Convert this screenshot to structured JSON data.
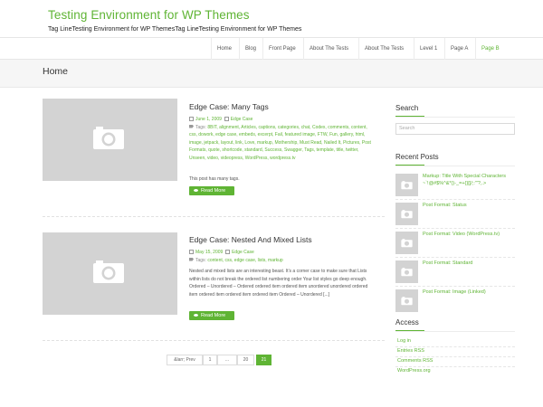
{
  "site": {
    "title": "Testing Environment for WP Themes",
    "description": "Tag LineTesting Environment for WP ThemesTag LineTesting Environment for WP Themes"
  },
  "nav": {
    "items": [
      {
        "label": "Home"
      },
      {
        "label": "Blog"
      },
      {
        "label": "Front Page"
      },
      {
        "label": "About The Tests"
      },
      {
        "label": "About The Tests"
      },
      {
        "label": "Level 1"
      },
      {
        "label": "Page A"
      },
      {
        "label": "Page B"
      }
    ],
    "active_item": "Page B"
  },
  "page": {
    "title": "Home"
  },
  "posts": [
    {
      "title": "Edge Case: Many Tags",
      "date": "June 1, 2009",
      "category": "Edge Case",
      "tags_label": "Tags:",
      "tags": "8BIT, alignment, Articles, captions, categories, chat, Codex, comments, content, css, dowork, edge case, embeds, excerpt, Fail, featured image, FTW, Fun, gallery, html, image, jetpack, layout, link, Love, markup, Mothership, Must Read, Nailed It, Pictures, Post Formats, quote, shortcode, standard, Success, Swagger, Tags, template, title, twitter, Unseen, video, videopress, WordPress, wordpress.tv",
      "excerpt": "This post has many tags.",
      "read_more": "Read More"
    },
    {
      "title": "Edge Case: Nested And Mixed Lists",
      "date": "May 15, 2009",
      "category": "Edge Case",
      "tags_label": "Tags:",
      "tags": "content, css, edge case, lists, markup",
      "excerpt": "Nested and mixed lists are an interesting beast. It’s a corner case to make sure that Lists within lists do not break the ordered list numbering order Your list styles go deep enough. Ordered – Unordered – Ordered ordered item ordered item unordered unordered ordered item ordered item ordered item ordered item Ordered – Unordered [...]",
      "read_more": "Read More"
    }
  ],
  "pagination": {
    "prev": "&larr; Prev",
    "pages": [
      "1",
      "...",
      "20",
      "21"
    ],
    "current": "21"
  },
  "sidebar": {
    "search": {
      "title": "Search",
      "placeholder": "Search"
    },
    "recent": {
      "title": "Recent Posts",
      "items": [
        "Markup: Title With Special Characters ~`!@#$%^&*()-_=+{}[]/;:'\"?,.>",
        "Post Format: Status",
        "Post Format: Video (WordPress.tv)",
        "Post Format: Standard",
        "Post Format: Image (Linked)"
      ]
    },
    "access": {
      "title": "Access",
      "links": [
        "Log in",
        "Entries RSS",
        "Comments RSS",
        "WordPress.org"
      ]
    }
  },
  "colors": {
    "accent": "#5fb434",
    "thumb": "#d3d3d3"
  },
  "icons": {
    "thumbnail": "camera-icon",
    "date": "calendar-icon",
    "category": "folder-icon",
    "tags": "tag-icon",
    "read_more": "eye-icon"
  }
}
